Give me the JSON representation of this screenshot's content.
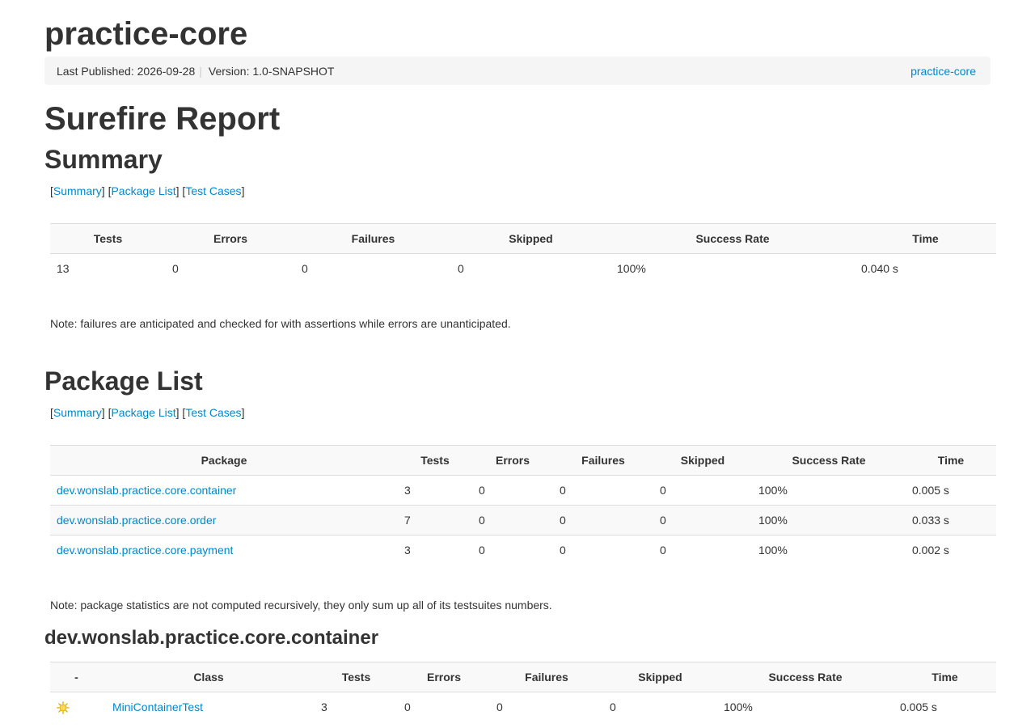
{
  "header": {
    "project_title": "practice-core",
    "last_published": "Last Published: 2026-09-28",
    "separator": "|",
    "version": "Version: 1.0-SNAPSHOT",
    "project_link": "practice-core"
  },
  "report_title": "Surefire Report",
  "nav": {
    "lb": "[",
    "rb": "]",
    "summary": "Summary",
    "package_list": "Package List",
    "test_cases": "Test Cases"
  },
  "summary": {
    "heading": "Summary",
    "columns": [
      "Tests",
      "Errors",
      "Failures",
      "Skipped",
      "Success Rate",
      "Time"
    ],
    "row": [
      "13",
      "0",
      "0",
      "0",
      "100%",
      "0.040 s"
    ],
    "note": "Note: failures are anticipated and checked for with assertions while errors are unanticipated."
  },
  "package_list": {
    "heading": "Package List",
    "columns": [
      "Package",
      "Tests",
      "Errors",
      "Failures",
      "Skipped",
      "Success Rate",
      "Time"
    ],
    "rows": [
      [
        "dev.wonslab.practice.core.container",
        "3",
        "0",
        "0",
        "0",
        "100%",
        "0.005 s"
      ],
      [
        "dev.wonslab.practice.core.order",
        "7",
        "0",
        "0",
        "0",
        "100%",
        "0.033 s"
      ],
      [
        "dev.wonslab.practice.core.payment",
        "3",
        "0",
        "0",
        "0",
        "100%",
        "0.002 s"
      ]
    ],
    "note": "Note: package statistics are not computed recursively, they only sum up all of its testsuites numbers."
  },
  "container_package": {
    "heading": "dev.wonslab.practice.core.container",
    "columns": [
      "-",
      "Class",
      "Tests",
      "Errors",
      "Failures",
      "Skipped",
      "Success Rate",
      "Time"
    ],
    "rows": [
      {
        "icon": "success-sun-icon",
        "cells": [
          "MiniContainerTest",
          "3",
          "0",
          "0",
          "0",
          "100%",
          "0.005 s"
        ]
      }
    ]
  },
  "colors": {
    "link": "#0088cc",
    "text": "#333333",
    "bar_bg": "#f5f5f5",
    "row_stripe": "#f9f9f9",
    "border": "#dddddd"
  }
}
